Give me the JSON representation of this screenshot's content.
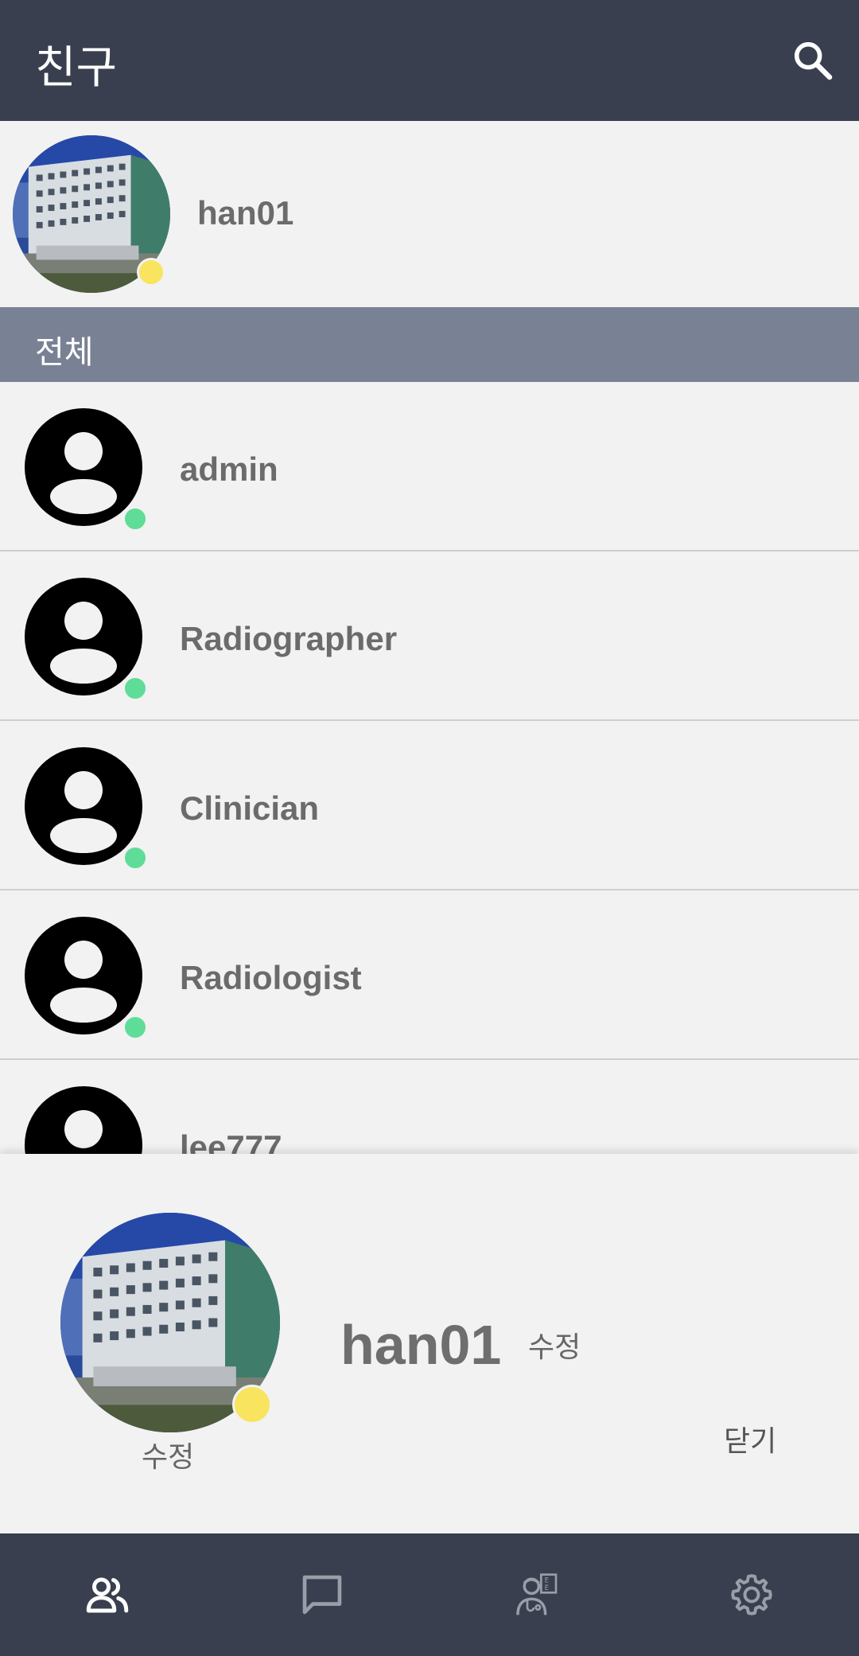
{
  "header": {
    "title": "친구"
  },
  "my_profile": {
    "name": "han01",
    "status_color": "#f8e45e"
  },
  "section": {
    "title": "전체"
  },
  "friends": [
    {
      "name": "admin",
      "status_color": "#5fdd98"
    },
    {
      "name": "Radiographer",
      "status_color": "#5fdd98"
    },
    {
      "name": "Clinician",
      "status_color": "#5fdd98"
    },
    {
      "name": "Radiologist",
      "status_color": "#5fdd98"
    },
    {
      "name": "lee777",
      "status_color": "#5fdd98"
    }
  ],
  "sheet": {
    "name": "han01",
    "name_edit_label": "수정",
    "photo_edit_label": "수정",
    "close_label": "닫기"
  },
  "nav": {
    "items": [
      "friends-icon",
      "chat-icon",
      "doctor-icon",
      "settings-icon"
    ],
    "active": "friends-icon"
  },
  "colors": {
    "appbar": "#393f4f",
    "section_header": "#798294",
    "online": "#5fdd98",
    "away": "#f8e45e"
  }
}
